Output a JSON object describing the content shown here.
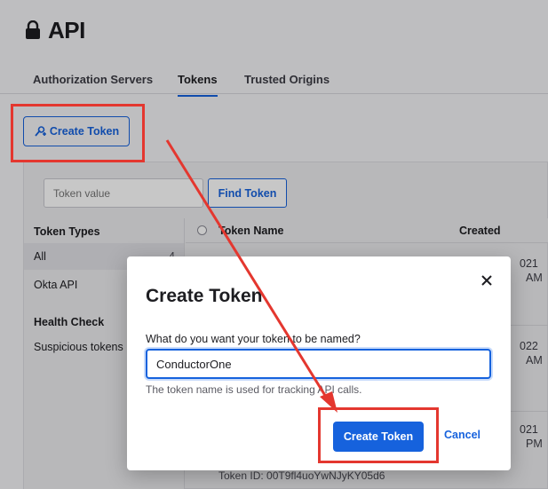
{
  "page": {
    "title": "API"
  },
  "tabs": [
    {
      "label": "Authorization Servers"
    },
    {
      "label": "Tokens"
    },
    {
      "label": "Trusted Origins"
    }
  ],
  "toolbar": {
    "create_label": "Create Token"
  },
  "search": {
    "placeholder": "Token value",
    "find_label": "Find Token"
  },
  "sidebar": {
    "heading_types": "Token Types",
    "items": [
      {
        "label": "All",
        "count": "4"
      },
      {
        "label": "Okta API"
      }
    ],
    "heading_health": "Health Check",
    "health_items": [
      {
        "label": "Suspicious tokens"
      }
    ]
  },
  "table": {
    "columns": [
      "Token Name",
      "Created"
    ],
    "fragments": [
      "021",
      "AM",
      "022",
      "AM",
      "021",
      "PM"
    ],
    "token_id": "Token ID: 00T9fl4uoYwNJyKY05d6"
  },
  "modal": {
    "title": "Create Token",
    "field_label": "What do you want your token to be named?",
    "field_value": "ConductorOne",
    "hint": "The token name is used for tracking API calls.",
    "create_label": "Create Token",
    "cancel_label": "Cancel"
  },
  "colors": {
    "accent": "#1662dd",
    "annotation": "#e4372f"
  },
  "icons": [
    "lock-icon",
    "add-token-icon",
    "close-icon"
  ]
}
